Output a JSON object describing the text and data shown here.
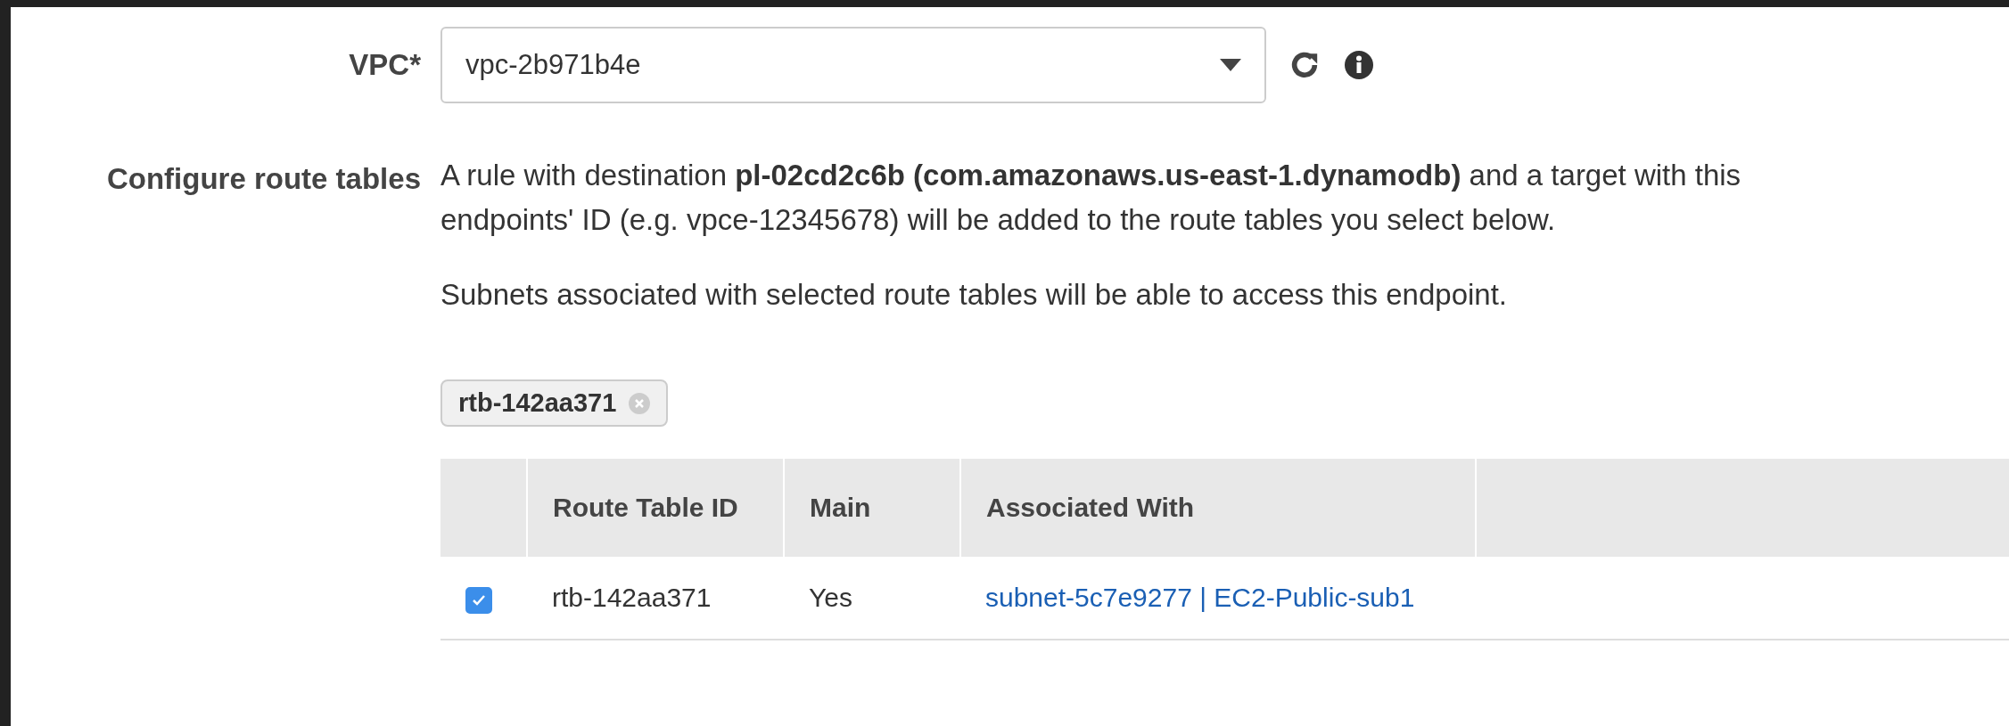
{
  "vpc": {
    "label": "VPC*",
    "value": "vpc-2b971b4e"
  },
  "route_tables": {
    "label": "Configure route tables",
    "description": "A rule with destination **pl-02cd2c6b (com.amazonaws.us-east-1.dynamodb)** and a target with this endpoints' ID (e.g. vpce-12345678) will be added to the route tables you select below.",
    "note": "Subnets associated with selected route tables will be able to access this endpoint.",
    "tokens": [
      "rtb-142aa371"
    ],
    "columns": [
      "Route Table ID",
      "Main",
      "Associated With"
    ],
    "rows": [
      {
        "selected": true,
        "id": "rtb-142aa371",
        "main": "Yes",
        "associated": "subnet-5c7e9277 | EC2-Public-sub1"
      }
    ]
  }
}
